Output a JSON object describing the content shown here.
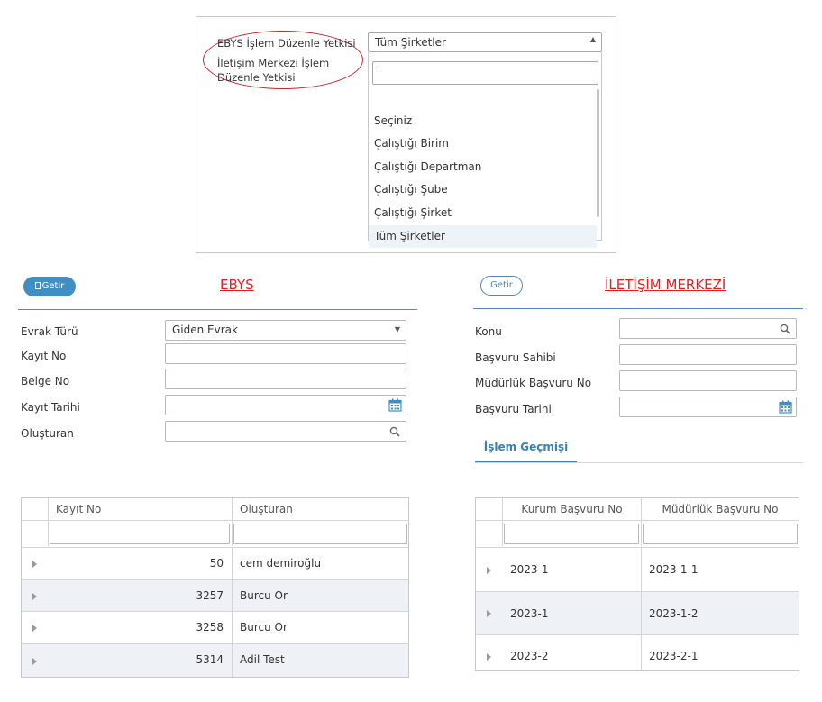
{
  "permission_popup": {
    "permissions": [
      "EBYS İşlem Düzenle Yetkisi",
      "İletişim Merkezi İşlem Düzenle Yetkisi"
    ],
    "scope_select_value": "Tüm Şirketler",
    "dropdown_options": [
      "Seçiniz",
      "Çalıştığı Birim",
      "Çalıştığı Departman",
      "Çalıştığı Şube",
      "Çalıştığı Şirket",
      "Tüm Şirketler"
    ],
    "selected_option": "Tüm Şirketler",
    "highlight_color": "#c0272d"
  },
  "ebys": {
    "getir_label": "Getir",
    "title": "EBYS",
    "fields": {
      "evrak_turu": {
        "label": "Evrak Türü",
        "value": "Giden Evrak"
      },
      "kayit_no": {
        "label": "Kayıt No",
        "value": ""
      },
      "belge_no": {
        "label": "Belge No",
        "value": ""
      },
      "kayit_tarihi": {
        "label": "Kayıt Tarihi",
        "value": ""
      },
      "olusturan": {
        "label": "Oluşturan",
        "value": ""
      }
    },
    "grid": {
      "columns": [
        "Kayıt No",
        "Oluşturan"
      ],
      "rows": [
        {
          "kayit_no": "50",
          "olusturan": "cem demiroğlu"
        },
        {
          "kayit_no": "3257",
          "olusturan": "Burcu Or"
        },
        {
          "kayit_no": "3258",
          "olusturan": "Burcu Or"
        },
        {
          "kayit_no": "5314",
          "olusturan": "Adil Test"
        }
      ]
    }
  },
  "iletisim": {
    "getir_label": "Getir",
    "title": "İLETİŞİM MERKEZİ",
    "fields": {
      "konu": {
        "label": "Konu",
        "value": ""
      },
      "basvuru_sahibi": {
        "label": "Başvuru Sahibi",
        "value": ""
      },
      "mudurluk_basvuru_no": {
        "label": "Müdürlük Başvuru No",
        "value": ""
      },
      "basvuru_tarihi": {
        "label": "Başvuru Tarihi",
        "value": ""
      }
    },
    "tab": "İşlem Geçmişi",
    "grid": {
      "columns": [
        "Kurum Başvuru No",
        "Müdürlük Başvuru No"
      ],
      "rows": [
        {
          "kurum_basvuru_no": "2023-1",
          "mudurluk_basvuru_no": "2023-1-1"
        },
        {
          "kurum_basvuru_no": "2023-1",
          "mudurluk_basvuru_no": "2023-1-2"
        },
        {
          "kurum_basvuru_no": "2023-2",
          "mudurluk_basvuru_no": "2023-2-1"
        }
      ]
    }
  },
  "colors": {
    "accent": "#3f8fc4",
    "title_red": "#e02020",
    "row_alt": "#eef2f6"
  }
}
